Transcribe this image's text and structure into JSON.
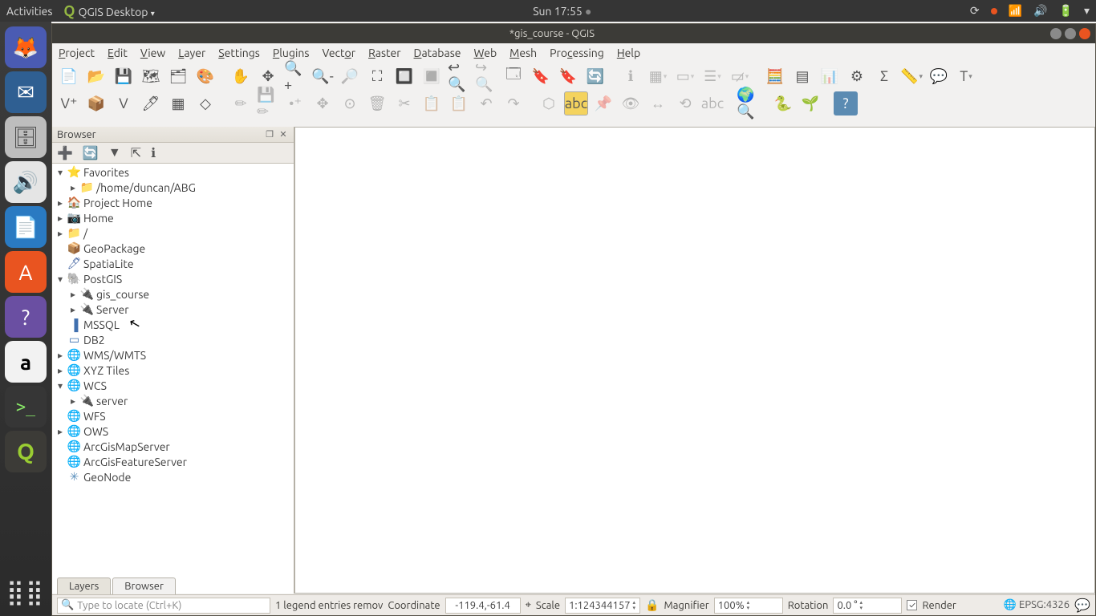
{
  "system": {
    "activities": "Activities",
    "app_indicator": "QGIS Desktop",
    "clock": "Sun 17:55"
  },
  "window": {
    "title": "*gis_course - QGIS"
  },
  "menu": {
    "project": "Project",
    "edit": "Edit",
    "view": "View",
    "layer": "Layer",
    "settings": "Settings",
    "plugins": "Plugins",
    "vector": "Vector",
    "raster": "Raster",
    "database": "Database",
    "web": "Web",
    "mesh": "Mesh",
    "processing": "Processing",
    "help": "Help"
  },
  "browser": {
    "title": "Browser",
    "tree": [
      {
        "d": 1,
        "exp": "▾",
        "icon": "⭐",
        "color": "#e8b32a",
        "label": "Favorites"
      },
      {
        "d": 2,
        "exp": "▸",
        "icon": "📁",
        "color": "#c9c29a",
        "label": "/home/duncan/ABG"
      },
      {
        "d": 1,
        "exp": "▸",
        "icon": "🏠",
        "color": "#7db954",
        "label": "Project Home"
      },
      {
        "d": 1,
        "exp": "▸",
        "icon": "📷",
        "color": "#888",
        "label": "Home"
      },
      {
        "d": 1,
        "exp": "▸",
        "icon": "📁",
        "color": "#c9c29a",
        "label": "/"
      },
      {
        "d": 1,
        "exp": "",
        "icon": "📦",
        "color": "#d2a24c",
        "label": "GeoPackage"
      },
      {
        "d": 1,
        "exp": "",
        "icon": "🖊",
        "color": "#4a6aa5",
        "label": "SpatiaLite"
      },
      {
        "d": 1,
        "exp": "▾",
        "icon": "🐘",
        "color": "#6c8aa6",
        "label": "PostGIS"
      },
      {
        "d": 2,
        "exp": "▸",
        "icon": "🔌",
        "color": "#c8a015",
        "label": "gis_course"
      },
      {
        "d": 2,
        "exp": "▸",
        "icon": "🔌",
        "color": "#c8a015",
        "label": "Server"
      },
      {
        "d": 1,
        "exp": "",
        "icon": "▐",
        "color": "#3f6fae",
        "label": "MSSQL"
      },
      {
        "d": 1,
        "exp": "",
        "icon": "▭",
        "color": "#3a6fb0",
        "label": "DB2"
      },
      {
        "d": 1,
        "exp": "▸",
        "icon": "🌐",
        "color": "#5b8bb2",
        "label": "WMS/WMTS"
      },
      {
        "d": 1,
        "exp": "▸",
        "icon": "🌐",
        "color": "#5b8bb2",
        "label": "XYZ Tiles"
      },
      {
        "d": 1,
        "exp": "▾",
        "icon": "🌐",
        "color": "#5b8bb2",
        "label": "WCS"
      },
      {
        "d": 2,
        "exp": "▸",
        "icon": "🔌",
        "color": "#c8a015",
        "label": "server"
      },
      {
        "d": 1,
        "exp": "",
        "icon": "🌐",
        "color": "#5b8bb2",
        "label": "WFS"
      },
      {
        "d": 1,
        "exp": "▸",
        "icon": "🌐",
        "color": "#5b8bb2",
        "label": "OWS"
      },
      {
        "d": 1,
        "exp": "",
        "icon": "🌐",
        "color": "#5b8bb2",
        "label": "ArcGisMapServer"
      },
      {
        "d": 1,
        "exp": "",
        "icon": "🌐",
        "color": "#5b8bb2",
        "label": "ArcGisFeatureServer"
      },
      {
        "d": 1,
        "exp": "",
        "icon": "✳",
        "color": "#5a8fbc",
        "label": "GeoNode"
      }
    ]
  },
  "tabs": {
    "layers": "Layers",
    "browser": "Browser"
  },
  "status": {
    "locator_placeholder": "Type to locate (Ctrl+K)",
    "message": "1 legend entries remov",
    "coord_label": "Coordinate",
    "coord_value": "-119.4,-61.4",
    "scale_label": "Scale",
    "scale_value": "1:124344157",
    "mag_label": "Magnifier",
    "mag_value": "100%",
    "rot_label": "Rotation",
    "rot_value": "0.0 °",
    "render_label": "Render",
    "epsg": "EPSG:4326"
  }
}
